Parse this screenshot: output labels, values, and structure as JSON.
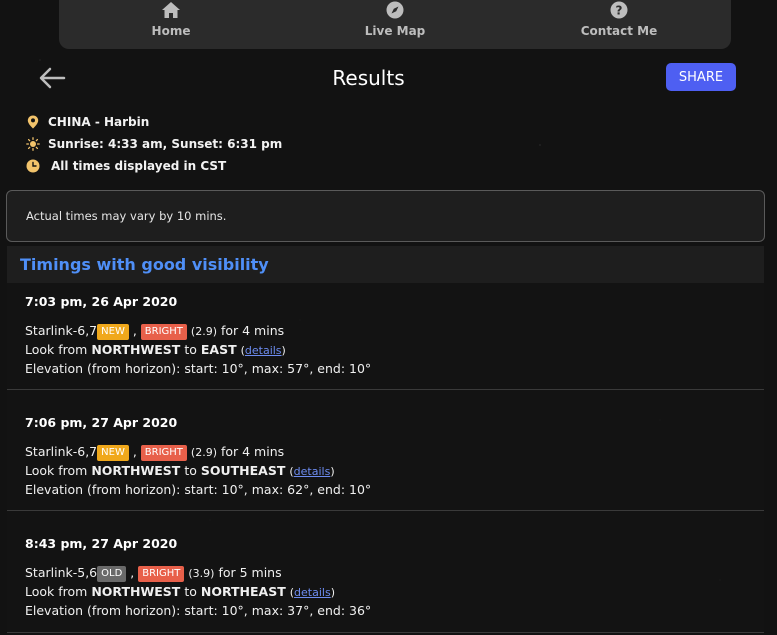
{
  "nav": {
    "items": [
      {
        "label": "Home",
        "icon": "home-icon"
      },
      {
        "label": "Live Map",
        "icon": "compass-icon"
      },
      {
        "label": "Contact Me",
        "icon": "help-icon"
      }
    ]
  },
  "header": {
    "title": "Results",
    "share_label": "SHARE"
  },
  "info": {
    "location": "CHINA - Harbin",
    "sun": "Sunrise: 4:33 am, Sunset: 6:31 pm",
    "timezone": "All times displayed in CST"
  },
  "notice": "Actual times may vary by 10 mins.",
  "section_heading": "Timings with good visibility",
  "passes": [
    {
      "time": "7:03 pm, 26 Apr 2020",
      "satellite": "Starlink-6,7",
      "badge1": "NEW",
      "sep": ",",
      "badge2": "BRIGHT",
      "magnitude": "(2.9)",
      "duration": "for 4 mins",
      "look_prefix": "Look from",
      "from": "NORTHWEST",
      "to_word": "to",
      "to": "EAST",
      "details": "details",
      "elevation": "Elevation (from horizon): start: 10°, max: 57°, end: 10°"
    },
    {
      "time": "7:06 pm, 27 Apr 2020",
      "satellite": "Starlink-6,7",
      "badge1": "NEW",
      "sep": ",",
      "badge2": "BRIGHT",
      "magnitude": "(2.9)",
      "duration": "for 4 mins",
      "look_prefix": "Look from",
      "from": "NORTHWEST",
      "to_word": "to",
      "to": "SOUTHEAST",
      "details": "details",
      "elevation": "Elevation (from horizon): start: 10°, max: 62°, end: 10°"
    },
    {
      "time": "8:43 pm, 27 Apr 2020",
      "satellite": "Starlink-5,6",
      "badge1": "OLD",
      "sep": ",",
      "badge2": "BRIGHT",
      "magnitude": "(3.9)",
      "duration": "for 5 mins",
      "look_prefix": "Look from",
      "from": "NORTHWEST",
      "to_word": "to",
      "to": "NORTHEAST",
      "details": "details",
      "elevation": "Elevation (from horizon): start: 10°, max: 37°, end: 36°"
    }
  ],
  "colors": {
    "accent": "#4e5ff2",
    "heading": "#4f8ff7",
    "badge_new": "#f0a81b",
    "badge_bright": "#e8604a",
    "badge_old": "#6a6a6a"
  }
}
